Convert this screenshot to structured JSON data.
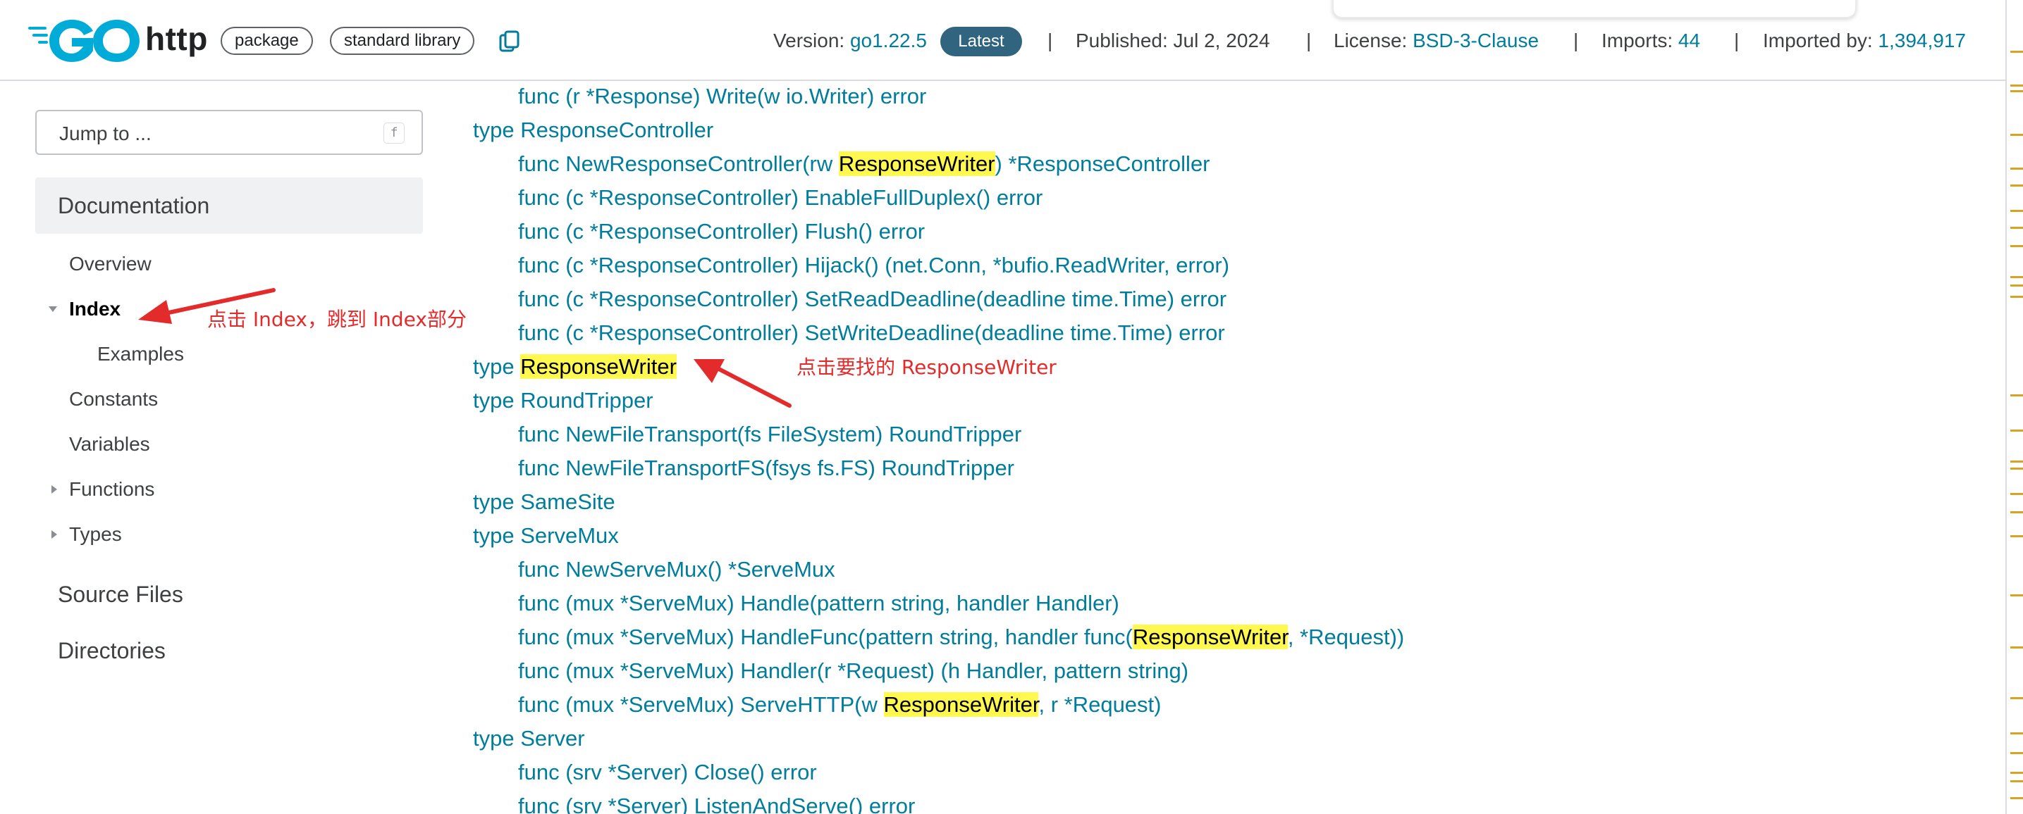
{
  "header": {
    "package_name": "http",
    "chips": [
      "package",
      "standard library"
    ],
    "version_label": "Version:",
    "version_value": "go1.22.5",
    "latest_badge": "Latest",
    "separator": "|",
    "published_label": "Published: Jul 2, 2024",
    "license_label": "License:",
    "license_value": "BSD-3-Clause",
    "imports_label": "Imports:",
    "imports_value": "44",
    "imported_by_label": "Imported by:",
    "imported_by_value": "1,394,917"
  },
  "sidebar": {
    "jump": {
      "placeholder": "Jump to ...",
      "shortcut": "f"
    },
    "documentation_heading": "Documentation",
    "items": [
      {
        "label": "Overview"
      },
      {
        "label": "Index"
      },
      {
        "label": "Examples"
      },
      {
        "label": "Constants"
      },
      {
        "label": "Variables"
      },
      {
        "label": "Functions"
      },
      {
        "label": "Types"
      }
    ],
    "source_files": "Source Files",
    "directories": "Directories"
  },
  "content": {
    "lines": [
      {
        "pre": "func (r *Response) Write(w io.Writer) error"
      },
      {
        "pre": "type ResponseController"
      },
      {
        "pre": "func NewResponseController(rw ",
        "hl": "ResponseWriter",
        "post": ") *ResponseController"
      },
      {
        "pre": "func (c *ResponseController) EnableFullDuplex() error"
      },
      {
        "pre": "func (c *ResponseController) Flush() error"
      },
      {
        "pre": "func (c *ResponseController) Hijack() (net.Conn, *bufio.ReadWriter, error)"
      },
      {
        "pre": "func (c *ResponseController) SetReadDeadline(deadline time.Time) error"
      },
      {
        "pre": "func (c *ResponseController) SetWriteDeadline(deadline time.Time) error"
      },
      {
        "pre": "type ",
        "hl": "ResponseWriter"
      },
      {
        "pre": "type RoundTripper"
      },
      {
        "pre": "func NewFileTransport(fs FileSystem) RoundTripper"
      },
      {
        "pre": "func NewFileTransportFS(fsys fs.FS) RoundTripper"
      },
      {
        "pre": "type SameSite"
      },
      {
        "pre": "type ServeMux"
      },
      {
        "pre": "func NewServeMux() *ServeMux"
      },
      {
        "pre": "func (mux *ServeMux) Handle(pattern string, handler Handler)"
      },
      {
        "pre": "func (mux *ServeMux) HandleFunc(pattern string, handler func(",
        "hl": "ResponseWriter",
        "post": ", *Request))"
      },
      {
        "pre": "func (mux *ServeMux) Handler(r *Request) (h Handler, pattern string)"
      },
      {
        "pre": "func (mux *ServeMux) ServeHTTP(w ",
        "hl": "ResponseWriter",
        "post": ", r *Request)"
      },
      {
        "pre": "type Server"
      },
      {
        "pre": "func (srv *Server) Close() error"
      },
      {
        "pre": "func (srv *Server) ListenAndServe() error"
      }
    ]
  },
  "annotations": {
    "index_note": "点击 Index，跳到 Index部分",
    "responsewriter_note": "点击要找的 ResponseWriter"
  },
  "colors": {
    "link": "#007d9c",
    "badge": "#31657f",
    "highlight": "#fff94f",
    "annotation": "#e32b2b",
    "go_logo": "#00acd7"
  },
  "icons": [
    "go-logo",
    "copy-icon",
    "chevron-down-icon",
    "chevron-right-icon",
    "red-arrow"
  ]
}
